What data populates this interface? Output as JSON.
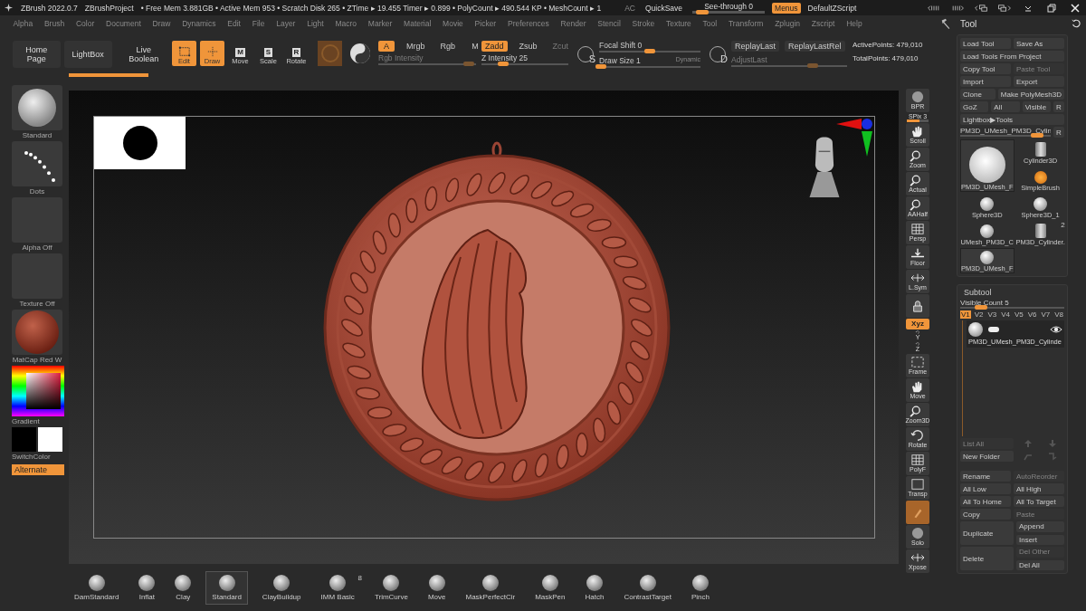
{
  "title_bar": {
    "app": "ZBrush 2022.0.7",
    "project": "ZBrushProject",
    "stats": "• Free Mem 3.881GB • Active Mem 953 • Scratch Disk 265 • ZTime ▸ 19.455 Timer ▸ 0.899 • PolyCount ▸ 490.544 KP • MeshCount ▸ 1",
    "ac": "AC",
    "quicksave": "QuickSave",
    "see_through": {
      "label": "See-through  0",
      "level": 0.05
    },
    "menus": {
      "label": "Menus",
      "selected": true
    },
    "script": "DefaultZScript"
  },
  "menu_bar": [
    "Alpha",
    "Brush",
    "Color",
    "Document",
    "Draw",
    "Dynamics",
    "Edit",
    "File",
    "Layer",
    "Light",
    "Macro",
    "Marker",
    "Material",
    "Movie",
    "Picker",
    "Preferences",
    "Render",
    "Stencil",
    "Stroke",
    "Texture",
    "Tool",
    "Transform",
    "Zplugin",
    "Zscript",
    "Help"
  ],
  "toolbar": {
    "nav": [
      "Home Page",
      "LightBox",
      "Live Boolean"
    ],
    "progress": {
      "level": 1
    },
    "modes": [
      {
        "label": "Edit",
        "kind": "edit",
        "selected": true
      },
      {
        "label": "Draw",
        "kind": "draw",
        "selected": true
      },
      {
        "label": "Move",
        "kind": "key",
        "key": "M",
        "selected": false
      },
      {
        "label": "Scale",
        "kind": "key",
        "key": "S",
        "selected": false
      },
      {
        "label": "Rotate",
        "kind": "key",
        "key": "R",
        "selected": false
      }
    ],
    "channels": [
      {
        "label": "A",
        "selected": true
      },
      {
        "label": "Mrgb",
        "selected": false
      },
      {
        "label": "Rgb",
        "selected": false
      },
      {
        "label": "M",
        "selected": false
      }
    ],
    "rgb_intensity": {
      "label": "Rgb Intensity",
      "disabled": true,
      "level": 0.93
    },
    "z_modes": [
      {
        "label": "Zadd",
        "selected": true,
        "disabled": false
      },
      {
        "label": "Zsub",
        "selected": false,
        "disabled": false
      },
      {
        "label": "Zcut",
        "selected": false,
        "disabled": true
      }
    ],
    "z_intensity": {
      "label": "Z Intensity 25",
      "level": 0.25
    },
    "stroke_key": "S",
    "focal_shift": {
      "label": "Focal Shift 0",
      "level": 0.5
    },
    "draw_size": {
      "label": "Draw Size 1",
      "level": 0.02,
      "note": "Dynamic"
    },
    "replay_key": "D",
    "replay_buttons": [
      "ReplayLast",
      "ReplayLastRel"
    ],
    "adjust_last": {
      "label": "AdjustLast",
      "disabled": true,
      "level": 0.7
    },
    "points": [
      "ActivePoints: 479,010",
      "TotalPoints: 479,010"
    ]
  },
  "left_panel": {
    "items": [
      {
        "label": "Standard",
        "kind": "brush"
      },
      {
        "label": "Dots",
        "kind": "stroke"
      },
      {
        "label": "Alpha Off",
        "kind": "empty"
      },
      {
        "label": "Texture Off",
        "kind": "empty"
      },
      {
        "label": "MatCap Red W",
        "kind": "material"
      }
    ],
    "gradient": "Gradient",
    "switch_color": "SwitchColor",
    "alternate": "Alternate"
  },
  "shelf": [
    {
      "label": "BPR",
      "kind": "bpr",
      "selected": false
    },
    {
      "label": "SPix 3",
      "kind": "slider",
      "level": 0.6
    },
    {
      "label": "Scroll",
      "kind": "hand",
      "selected": false
    },
    {
      "label": "Zoom",
      "kind": "zoom",
      "selected": false
    },
    {
      "label": "Actual",
      "kind": "zoom",
      "selected": false
    },
    {
      "label": "AAHalf",
      "kind": "zoom",
      "selected": false
    },
    {
      "label": "Persp",
      "kind": "grid",
      "selected": false
    },
    {
      "label": "Floor",
      "kind": "floor",
      "selected": false
    },
    {
      "label": "L.Sym",
      "kind": "arrows",
      "selected": false
    },
    {
      "kind": "lock",
      "selected": false
    },
    {
      "label": "Xyz",
      "kind": "xyz",
      "selected": true
    },
    {
      "label": "Y",
      "kind": "axis",
      "selected": false
    },
    {
      "label": "Z",
      "kind": "axis",
      "selected": false
    },
    {
      "label": "Frame",
      "kind": "frame",
      "selected": false
    },
    {
      "label": "Move",
      "kind": "hand",
      "selected": false
    },
    {
      "label": "Zoom3D",
      "kind": "zoom",
      "selected": false
    },
    {
      "label": "Rotate",
      "kind": "rotate",
      "selected": false
    },
    {
      "label": "PolyF",
      "kind": "grid",
      "selected": false
    },
    {
      "label": "Transp",
      "kind": "cube",
      "selected": false
    },
    {
      "kind": "ghost",
      "selected": true
    },
    {
      "label": "Solo",
      "kind": "solo",
      "selected": false
    },
    {
      "label": "Xpose",
      "kind": "arrows",
      "selected": false
    }
  ],
  "tool_panel": {
    "title": "Tool",
    "rows": [
      [
        {
          "label": "Load Tool",
          "disabled": false
        },
        {
          "label": "Save As",
          "disabled": false
        }
      ],
      [
        {
          "label": "Load Tools From Project",
          "disabled": false
        }
      ],
      [
        {
          "label": "Copy Tool",
          "disabled": false
        },
        {
          "label": "Paste Tool",
          "disabled": true
        }
      ],
      [
        {
          "label": "Import",
          "disabled": false
        },
        {
          "label": "Export",
          "disabled": false
        }
      ],
      [
        {
          "label": "Clone",
          "disabled": false
        },
        {
          "label": "Make PolyMesh3D",
          "disabled": false
        }
      ],
      [
        {
          "label": "GoZ",
          "disabled": false
        },
        {
          "label": "All",
          "disabled": false
        },
        {
          "label": "Visible",
          "disabled": false
        },
        {
          "label": "R",
          "disabled": false
        }
      ],
      [
        {
          "label": "Lightbox▶Tools",
          "disabled": false
        }
      ]
    ],
    "current": {
      "label": "PM3D_UMesh_PM3D_Cylin",
      "level": 0.85,
      "r": "R"
    },
    "tools": [
      {
        "label": "PM3D_UMesh_F",
        "kind": "coin",
        "selected": true
      },
      {
        "label": "Sphere3D",
        "kind": "sphere",
        "selected": false
      },
      {
        "label": "UMesh_PM3D_C",
        "kind": "sphere",
        "selected": false
      },
      {
        "label": "PM3D_UMesh_F",
        "kind": "sphere",
        "selected": true
      },
      {
        "label": "Cylinder3D",
        "kind": "cylinder",
        "selected": false
      },
      {
        "label": "SimpleBrush",
        "kind": "brush",
        "selected": false
      },
      {
        "label": "Sphere3D_1",
        "kind": "sphere",
        "selected": false
      },
      {
        "label": "PM3D_Cylinder.",
        "kind": "cylinder",
        "count": "2",
        "selected": false
      }
    ]
  },
  "subtool": {
    "title": "Subtool",
    "visible_count": {
      "label": "Visible Count 5",
      "level": 0.2
    },
    "versions": [
      {
        "label": "V1",
        "selected": true
      },
      {
        "label": "V2",
        "selected": false
      },
      {
        "label": "V3",
        "selected": false
      },
      {
        "label": "V4",
        "selected": false
      },
      {
        "label": "V5",
        "selected": false
      },
      {
        "label": "V6",
        "selected": false
      },
      {
        "label": "V7",
        "selected": false
      },
      {
        "label": "V8",
        "selected": false
      }
    ],
    "item": {
      "name": "PM3D_UMesh_PM3D_Cylinde",
      "visible": true
    },
    "list_all": {
      "label": "List All",
      "disabled": true
    },
    "new_folder": {
      "label": "New Folder",
      "disabled": false
    },
    "rows": [
      [
        {
          "label": "Rename",
          "disabled": false
        },
        {
          "label": "AutoReorder",
          "disabled": true
        }
      ],
      [
        {
          "label": "All Low",
          "disabled": false
        },
        {
          "label": "All High",
          "disabled": false
        }
      ],
      [
        {
          "label": "All To Home",
          "disabled": false
        },
        {
          "label": "All To Target",
          "disabled": false
        }
      ],
      [
        {
          "label": "Copy",
          "disabled": false
        },
        {
          "label": "Paste",
          "disabled": true
        }
      ]
    ],
    "duplicate": {
      "label": "Duplicate",
      "options": [
        {
          "label": "Append",
          "disabled": false
        },
        {
          "label": "Insert",
          "disabled": false
        }
      ]
    },
    "delete": {
      "label": "Delete",
      "options": [
        {
          "label": "Del Other",
          "disabled": true
        },
        {
          "label": "Del All",
          "disabled": false
        }
      ]
    }
  },
  "brush_bar": [
    {
      "label": "DamStandard",
      "selected": false
    },
    {
      "label": "Inflat",
      "selected": false
    },
    {
      "label": "Clay",
      "selected": false
    },
    {
      "label": "Standard",
      "selected": true
    },
    {
      "label": "ClayBuildup",
      "selected": false
    },
    {
      "label": "IMM Basic",
      "count": "8",
      "selected": false
    },
    {
      "label": "TrimCurve",
      "selected": false
    },
    {
      "label": "Move",
      "selected": false
    },
    {
      "label": "MaskPerfectCir",
      "selected": false
    },
    {
      "label": "MaskPen",
      "selected": false
    },
    {
      "label": "Hatch",
      "selected": false
    },
    {
      "label": "ContrastTarget",
      "selected": false
    },
    {
      "label": "Pinch",
      "selected": false
    }
  ]
}
